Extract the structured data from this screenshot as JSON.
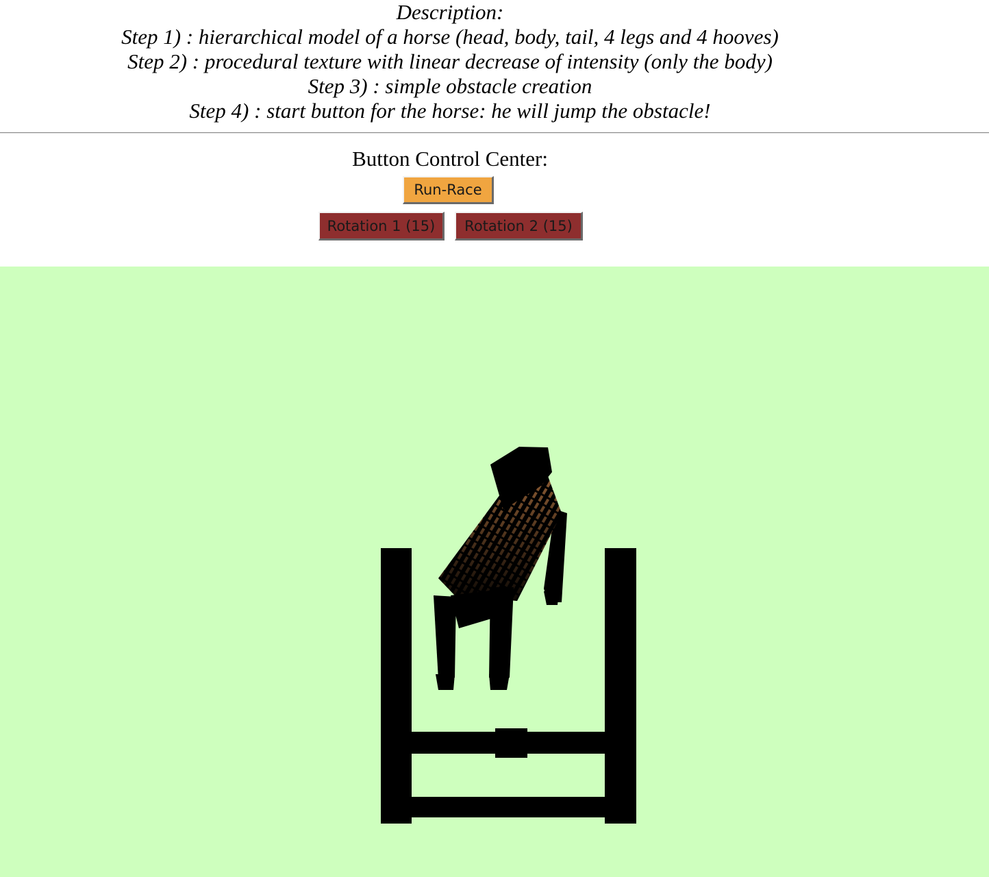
{
  "description": {
    "title": "Description:",
    "steps": [
      "Step 1) : hierarchical model of a horse (head, body, tail, 4 legs and 4 hooves)",
      "Step 2) : procedural texture with linear decrease of intensity (only the body)",
      "Step 3) : simple obstacle creation",
      "Step 4) : start button for the horse: he will jump the obstacle!"
    ]
  },
  "controls": {
    "title": "Button Control Center:",
    "run_race_label": "Run-Race",
    "rotation1_label": "Rotation 1 (15)",
    "rotation2_label": "Rotation 2 (15)"
  },
  "colors": {
    "canvas_background": "#ceffbe",
    "run_button": "#f0a540",
    "rotation_buttons": "#8e2e2e",
    "horse_body_texture": "#8a5a32",
    "obstacle": "#000000"
  }
}
